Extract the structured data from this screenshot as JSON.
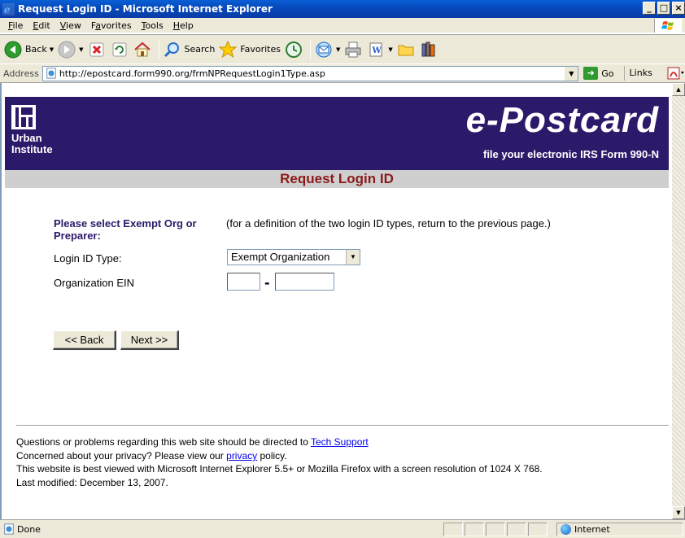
{
  "window": {
    "title": "Request Login ID - Microsoft Internet Explorer",
    "controls": [
      "_",
      "□",
      "×"
    ]
  },
  "menu": [
    {
      "label": "File",
      "accel": "F",
      "rest": "ile"
    },
    {
      "label": "Edit",
      "accel": "E",
      "rest": "dit"
    },
    {
      "label": "View",
      "accel": "V",
      "rest": "iew"
    },
    {
      "label": "Favorites",
      "accel": "a",
      "pre": "F",
      "rest": "vorites"
    },
    {
      "label": "Tools",
      "accel": "T",
      "rest": "ools"
    },
    {
      "label": "Help",
      "accel": "H",
      "rest": "elp"
    }
  ],
  "toolbar": {
    "back_label": "Back",
    "search_label": "Search",
    "favorites_label": "Favorites"
  },
  "address": {
    "label": "Address",
    "url": "http://epostcard.form990.org/frmNPRequestLogin1Type.asp",
    "go_label": "Go",
    "links_label": "Links",
    "links_chevron": "»"
  },
  "banner": {
    "org_line1": "Urban",
    "org_line2": "Institute",
    "brand": "e-Postcard",
    "brand_sub": "file your electronic IRS Form 990-N"
  },
  "page": {
    "heading": "Request Login ID",
    "select_prompt": "Please select Exempt Org or Preparer:",
    "definition_note": "(for a definition of the two login ID types, return to the previous page.)",
    "login_type_label": "Login ID Type:",
    "login_type_value": "Exempt Organization",
    "ein_label": "Organization EIN",
    "ein_dash": "-",
    "back_button": "<< Back",
    "next_button": "Next >>"
  },
  "footer": {
    "q_text": "Questions or problems regarding this web site should be directed to ",
    "q_link": "Tech Support",
    "privacy_pre": "Concerned about your privacy? Please view our ",
    "privacy_link": "privacy",
    "privacy_post": " policy.",
    "browser_note": "This website is best viewed with Microsoft Internet Explorer 5.5+ or Mozilla Firefox with a screen resolution of 1024 X 768.",
    "modified": "Last modified: December 13, 2007."
  },
  "status": {
    "text": "Done",
    "zone": "Internet"
  },
  "colors": {
    "banner_bg": "#2b1a6a",
    "heading_color": "#8b1a1a",
    "link_color": "#0000ee"
  }
}
